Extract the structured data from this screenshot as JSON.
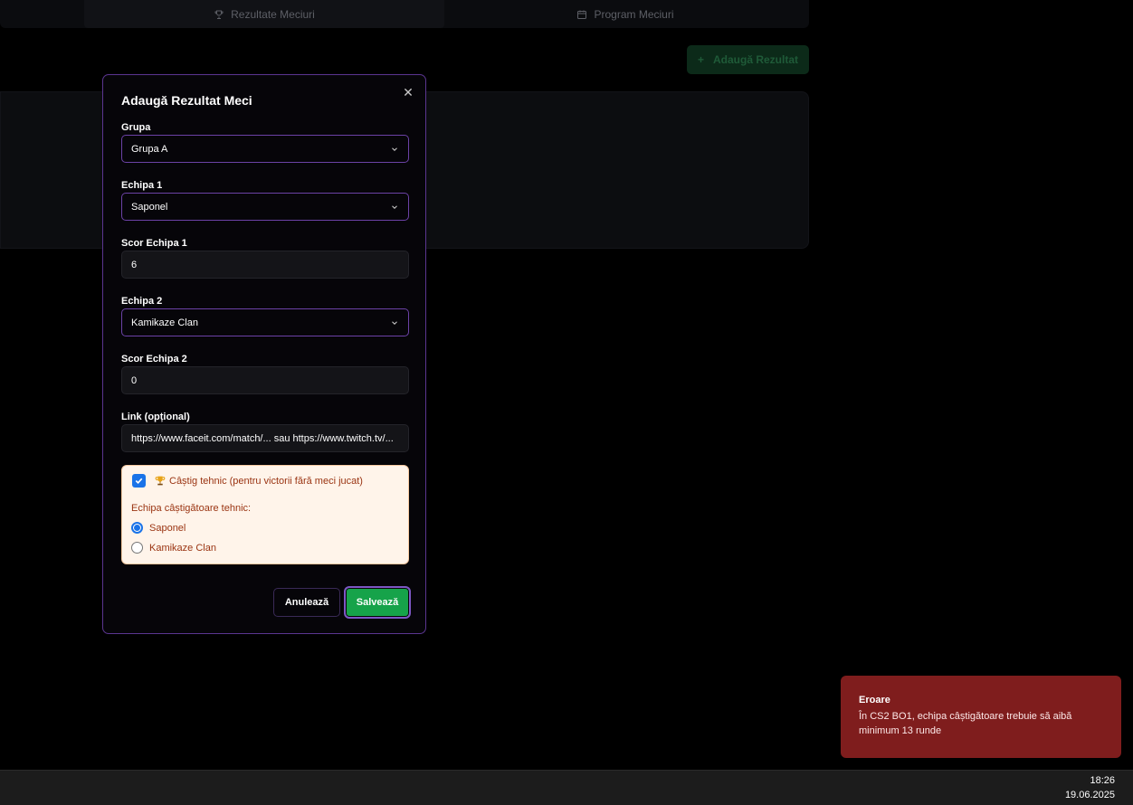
{
  "background": {
    "tabs": [
      {
        "label": "Rezultate Meciuri",
        "icon": "trophy-icon"
      },
      {
        "label": "Program Meciuri",
        "icon": "calendar-icon"
      }
    ],
    "add_button_label": "Adaugă Rezultat"
  },
  "modal": {
    "title": "Adaugă Rezultat Meci",
    "close_icon": "close-icon",
    "fields": {
      "group": {
        "label": "Grupa",
        "value": "Grupa A"
      },
      "team1": {
        "label": "Echipa 1",
        "value": "Saponel"
      },
      "score1": {
        "label": "Scor Echipa 1",
        "value": "6"
      },
      "team2": {
        "label": "Echipa 2",
        "value": "Kamikaze Clan"
      },
      "score2": {
        "label": "Scor Echipa 2",
        "value": "0"
      },
      "link": {
        "label": "Link (opțional)",
        "placeholder": "https://www.faceit.com/match/... sau https://www.twitch.tv/..."
      }
    },
    "technical_win": {
      "checked": true,
      "label": "Câștig tehnic (pentru victorii fără meci jucat)",
      "winner_label": "Echipa câștigătoare tehnic:",
      "options": [
        {
          "label": "Saponel",
          "selected": true
        },
        {
          "label": "Kamikaze Clan",
          "selected": false
        }
      ]
    },
    "cancel_label": "Anulează",
    "save_label": "Salvează"
  },
  "toast": {
    "title": "Eroare",
    "message": "În CS2 BO1, echipa câștigătoare trebuie să aibă minimum 13 runde"
  },
  "taskbar": {
    "time": "18:26",
    "date": "19.06.2025"
  },
  "colors": {
    "accent": "#6b42a6",
    "save": "#16a34a",
    "toast_bg": "#7f1d1d",
    "tech_box_bg": "#fff4ea"
  }
}
